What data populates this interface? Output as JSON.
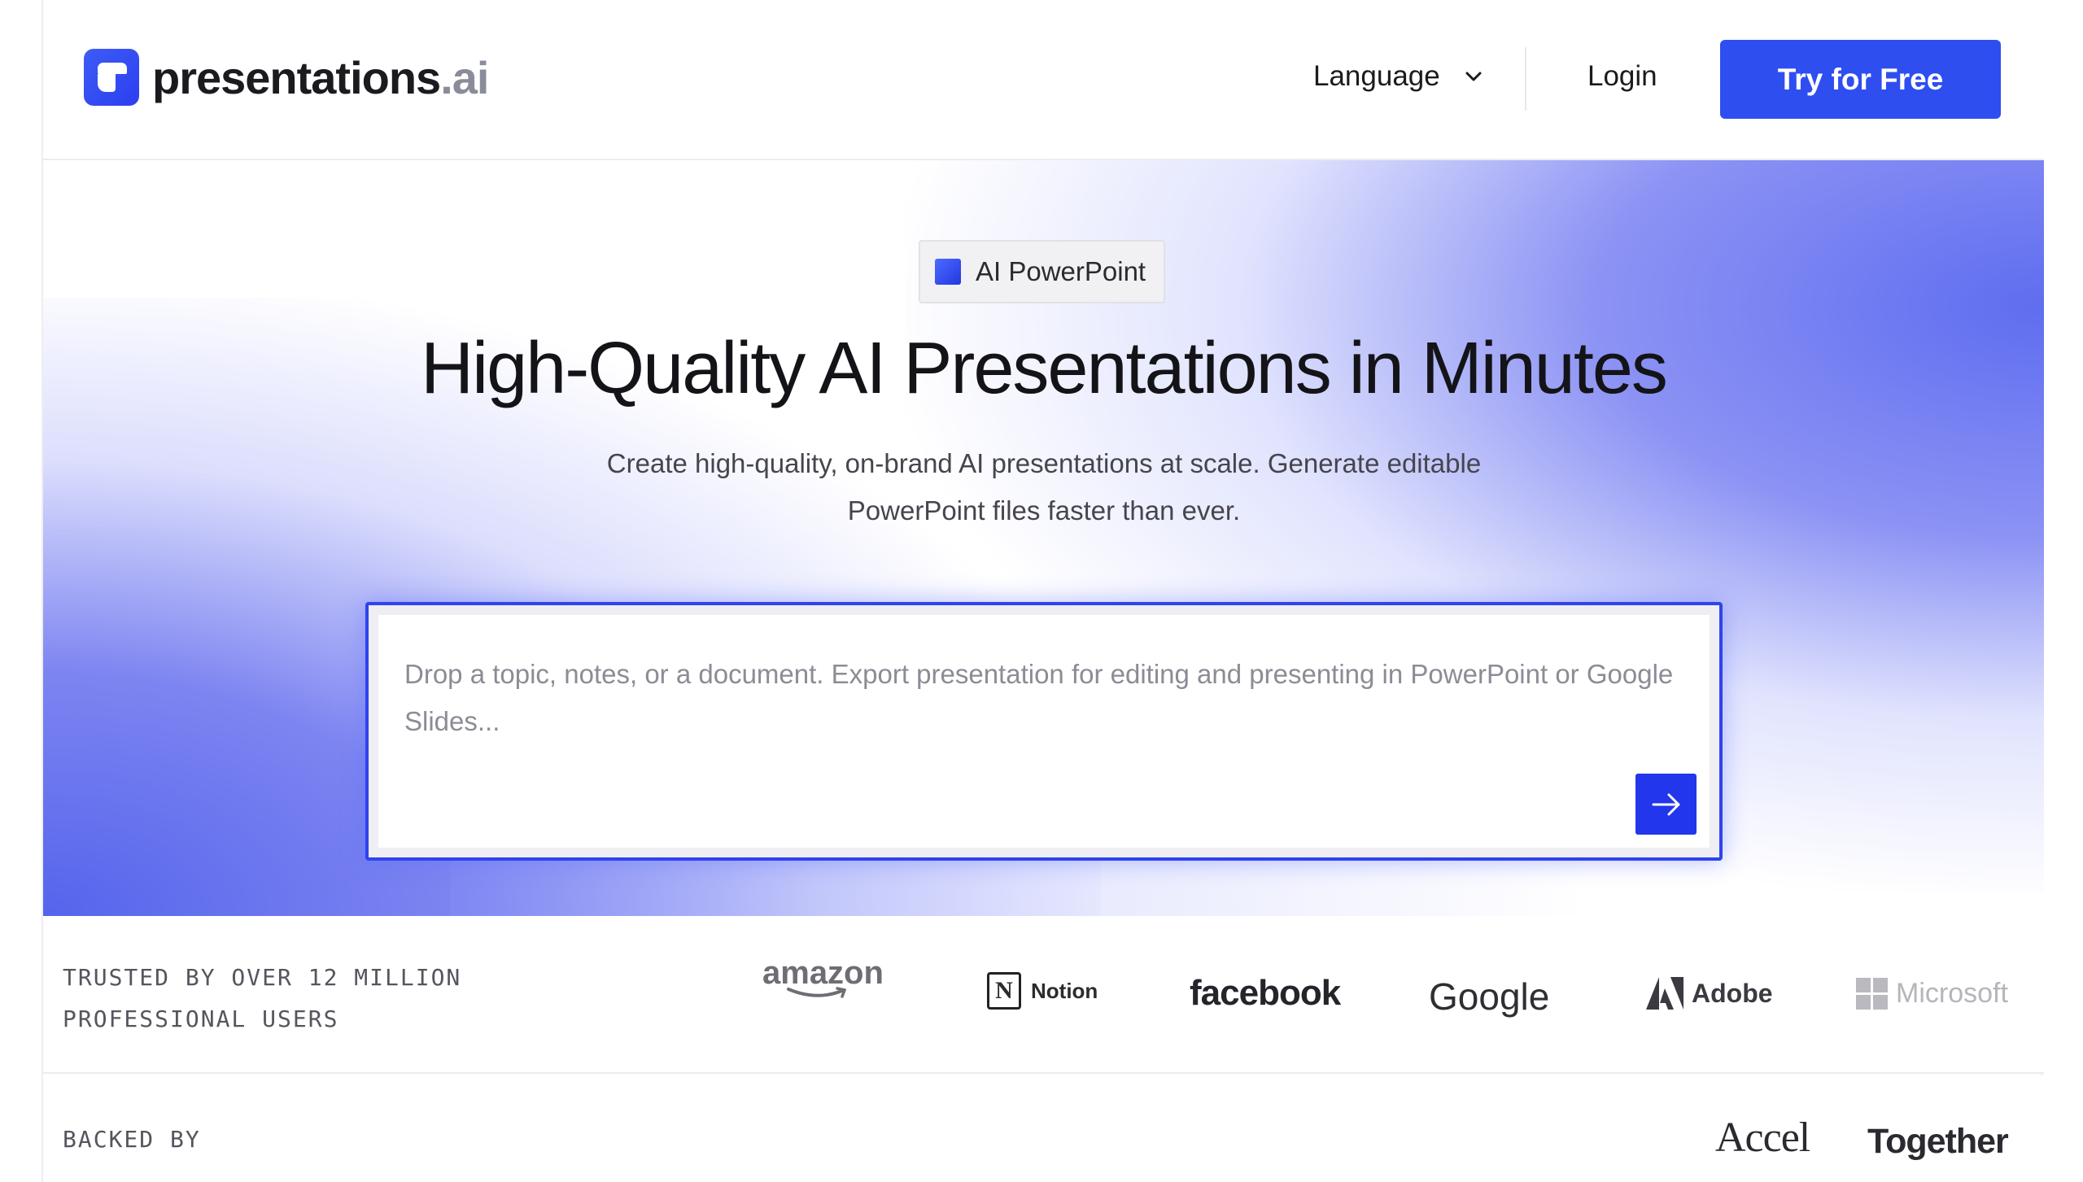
{
  "header": {
    "logo_text": "presentations",
    "logo_suffix": ".ai",
    "language_label": "Language",
    "login_label": "Login",
    "cta_label": "Try for Free"
  },
  "hero": {
    "badge_label": "AI PowerPoint",
    "title": "High-Quality AI Presentations in Minutes",
    "subtitle": "Create high-quality, on-brand AI presentations at scale. Generate editable PowerPoint files faster than ever.",
    "prompt_placeholder": "Drop a topic, notes, or a document. Export presentation for editing and presenting in PowerPoint or Google Slides..."
  },
  "trusted": {
    "label_line1": "TRUSTED BY OVER 12 MILLION",
    "label_line2": "PROFESSIONAL USERS",
    "logos": [
      "amazon",
      "Notion",
      "facebook",
      "Google",
      "Adobe",
      "Microsoft"
    ]
  },
  "backed": {
    "label": "BACKED BY",
    "investors": [
      "Accel",
      "Together"
    ]
  },
  "colors": {
    "accent": "#2f4ef0",
    "send_button": "#2236ec"
  }
}
